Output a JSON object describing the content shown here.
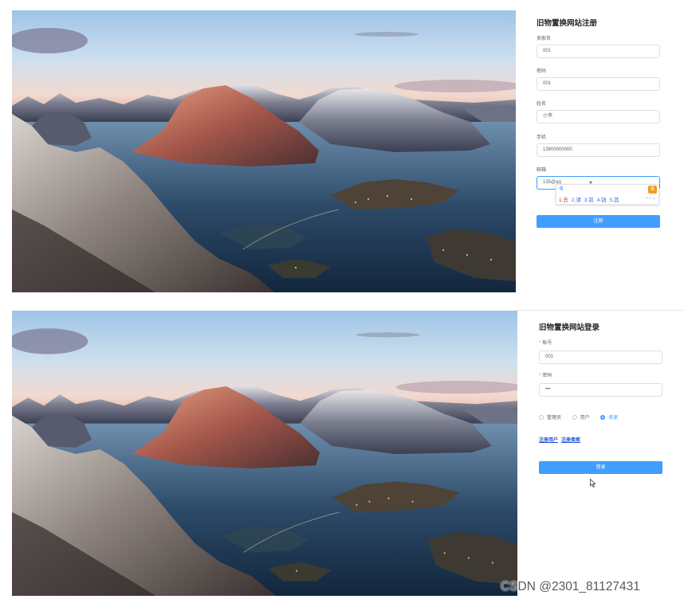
{
  "register": {
    "title": "旧物置换网站注册",
    "fields": [
      {
        "label": "卖家名",
        "value": "001"
      },
      {
        "label": "密码",
        "value": "001"
      },
      {
        "label": "姓名",
        "value": "小李"
      },
      {
        "label": "手机",
        "value": "13800000000"
      },
      {
        "label": "邮箱",
        "value": "135@qq"
      }
    ],
    "ime": {
      "composition": "q",
      "candidates": [
        "1.去",
        "2.请",
        "3.前",
        "4.钱",
        "5.其"
      ],
      "nav": "‹ › ⌄",
      "logo": "S"
    },
    "submit_label": "注册"
  },
  "login": {
    "title": "旧物置换网站登录",
    "account_label": "账号",
    "account_value": "001",
    "password_label": "密码",
    "password_value": "•••",
    "required_mark": "*",
    "roles": [
      {
        "label": "管理员",
        "checked": false
      },
      {
        "label": "用户",
        "checked": false
      },
      {
        "label": "卖家",
        "checked": true
      }
    ],
    "link_register_user": "注册用户",
    "link_register_seller": "注册卖家",
    "submit_label": "登录"
  },
  "watermark": "CSDN @2301_81127431",
  "colors": {
    "primary": "#409eff",
    "required": "#f56c6c",
    "link": "#1d4ed8"
  }
}
